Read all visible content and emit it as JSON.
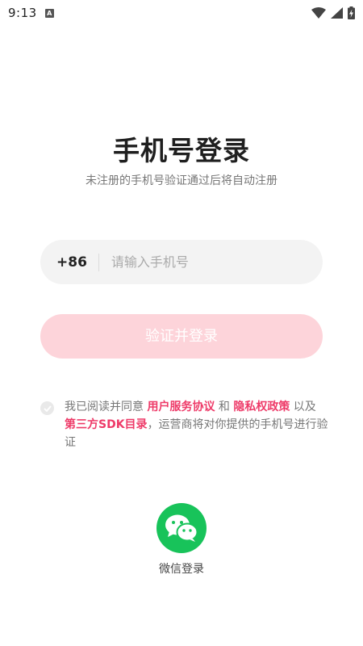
{
  "status_bar": {
    "time": "9:13",
    "notification_letter": "A",
    "icons": [
      "notification-a-icon",
      "wifi-icon",
      "signal-icon",
      "battery-charging-icon"
    ]
  },
  "login": {
    "title": "手机号登录",
    "subtitle": "未注册的手机号验证通过后将自动注册",
    "country_code": "+86",
    "phone_placeholder": "请输入手机号",
    "phone_value": "",
    "submit_label": "验证并登录"
  },
  "agreement": {
    "checked": false,
    "text_1": "我已阅读并同意 ",
    "link_terms": "用户服务协议",
    "text_2": " 和 ",
    "link_privacy": "隐私权政策",
    "text_3": " 以及 ",
    "link_sdk": "第三方SDK目录",
    "text_4": "，运营商将对你提供的手机号进行验证"
  },
  "wechat": {
    "label": "微信登录"
  },
  "colors": {
    "accent_pink": "#ee3a68",
    "button_disabled": "#fdd4da",
    "wechat_green": "#18c35a"
  }
}
